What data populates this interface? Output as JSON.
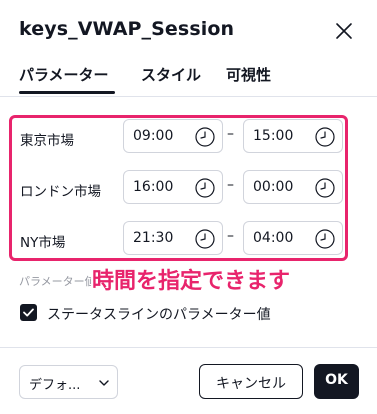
{
  "dialog": {
    "title": "keys_VWAP_Session"
  },
  "tabs": [
    {
      "label": "パラメーター",
      "active": true
    },
    {
      "label": "スタイル",
      "active": false
    },
    {
      "label": "可視性",
      "active": false
    }
  ],
  "sessions": [
    {
      "label": "東京市場",
      "start": "09:00",
      "end": "15:00"
    },
    {
      "label": "ロンドン市場",
      "start": "16:00",
      "end": "00:00"
    },
    {
      "label": "NY市場",
      "start": "21:30",
      "end": "04:00"
    }
  ],
  "range_separator": "–",
  "partial_label": "パラメーター値",
  "annotation_text": "時間を指定できます",
  "status_line_checkbox": {
    "label": "ステータスラインのパラメーター値",
    "checked": true
  },
  "footer": {
    "defaults_label": "デフォ...",
    "cancel_label": "キャンセル",
    "ok_label": "OK"
  },
  "colors": {
    "highlight": "#e8246c",
    "text": "#131722",
    "border": "#d1d4dc"
  },
  "icons": {
    "close": "close-icon",
    "clock": "clock-icon",
    "check": "check-icon",
    "chevron": "chevron-down-icon"
  }
}
